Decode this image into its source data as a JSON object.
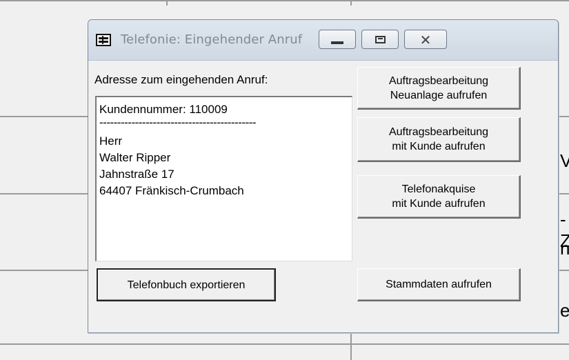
{
  "background": {
    "glyphs": [
      "V",
      "-Z",
      "n",
      "e"
    ]
  },
  "dialog": {
    "title": "Telefonie: Eingehender Anruf",
    "title_icon": "form-window-icon",
    "window_buttons": {
      "minimize_icon": "minimize-icon",
      "maximize_icon": "maximize-icon",
      "close_icon": "close-icon",
      "close_glyph": "✕"
    },
    "address_label": "Adresse zum eingehenden Anruf:",
    "address_lines": [
      "Kundennummer: 110009",
      "--------------------------------------------",
      "Herr",
      "Walter Ripper",
      "Jahnstraße 17",
      "64407 Fränkisch-Crumbach"
    ],
    "buttons": {
      "new_order": [
        "Auftragsbearbeitung",
        "Neuanlage aufrufen"
      ],
      "order_with_customer": [
        "Auftragsbearbeitung",
        "mit Kunde aufrufen"
      ],
      "telephone_acquisition": [
        "Telefonakquise",
        "mit Kunde aufrufen"
      ],
      "export_phonebook": "Telefonbuch exportieren",
      "master_data": "Stammdaten aufrufen"
    }
  }
}
